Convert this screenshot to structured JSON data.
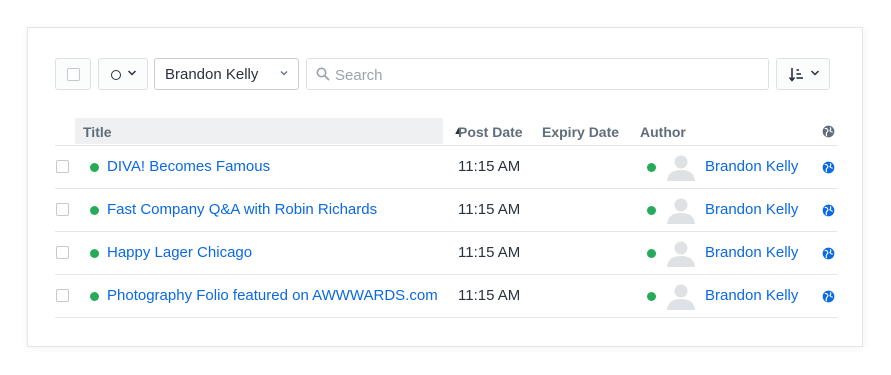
{
  "toolbar": {
    "user_filter": "Brandon Kelly",
    "search_placeholder": "Search"
  },
  "table": {
    "headers": {
      "title": "Title",
      "title_sort_indicator": "▲",
      "post_date": "Post Date",
      "expiry_date": "Expiry Date",
      "author": "Author"
    },
    "rows": [
      {
        "title": "DIVA! Becomes Famous",
        "post_date": "11:15 AM",
        "expiry_date": "",
        "author": "Brandon Kelly"
      },
      {
        "title": "Fast Company Q&A with Robin Richards",
        "post_date": "11:15 AM",
        "expiry_date": "",
        "author": "Brandon Kelly"
      },
      {
        "title": "Happy Lager Chicago",
        "post_date": "11:15 AM",
        "expiry_date": "",
        "author": "Brandon Kelly"
      },
      {
        "title": "Photography Folio featured on AWWWARDS.com",
        "post_date": "11:15 AM",
        "expiry_date": "",
        "author": "Brandon Kelly"
      }
    ]
  },
  "colors": {
    "link": "#0b69e3",
    "status_live": "#27ab5a",
    "header_text": "#606d7b",
    "border": "#e3e5e8"
  },
  "icons": {
    "status_filter": "circle-icon",
    "search": "search-icon",
    "sort": "sort-descending-icon",
    "site": "globe-icon",
    "avatar": "user-avatar-icon"
  }
}
